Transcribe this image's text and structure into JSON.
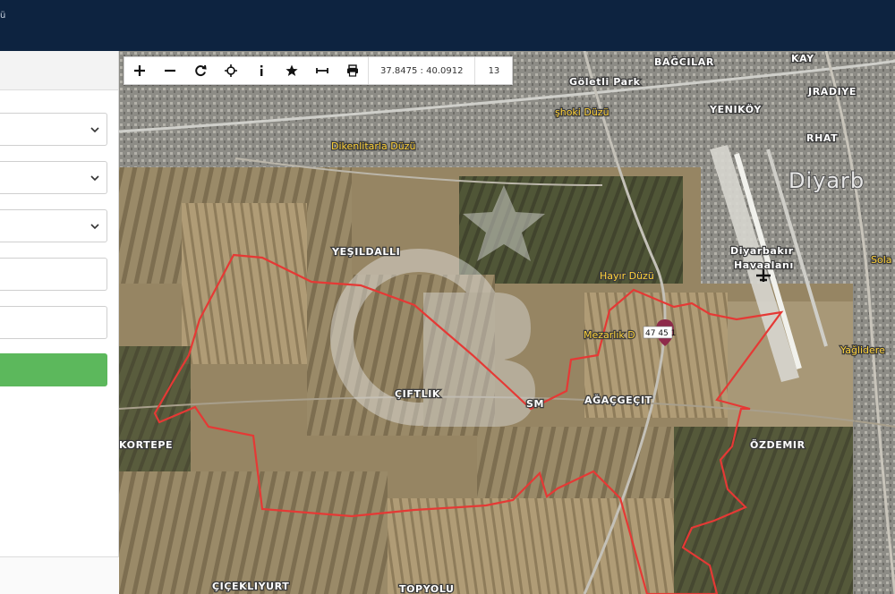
{
  "header": {
    "crumb": "ü"
  },
  "toolbar": {
    "tools": [
      {
        "name": "zoom-in-button",
        "icon": "plus-icon"
      },
      {
        "name": "zoom-out-button",
        "icon": "minus-icon"
      },
      {
        "name": "refresh-button",
        "icon": "refresh-icon"
      },
      {
        "name": "locate-button",
        "icon": "crosshair-icon"
      },
      {
        "name": "info-button",
        "icon": "info-icon"
      },
      {
        "name": "favorite-button",
        "icon": "star-icon"
      },
      {
        "name": "measure-button",
        "icon": "measure-icon"
      },
      {
        "name": "print-button",
        "icon": "print-icon"
      }
    ],
    "coordinates": "37.8475 : 40.0912",
    "zoom_level": "13"
  },
  "map": {
    "labels": {
      "bagcilar": "BAĞCILAR",
      "kay": "KAY",
      "goletli": "Göletli Park",
      "jradiye": "JRADIYE",
      "sohoki": "şhoki Düzü",
      "yenikoy": "YENIKÖY",
      "dikenli": "Dikenlitarla Düzü",
      "rhat": "RHAT",
      "diyarb": "Diyarb",
      "yesildalli": "YEŞILDALLI",
      "airport1": "Diyarbakır",
      "airport2": "Havaalanı",
      "solak": "Sola",
      "hayir": "Hayır Düzü",
      "mezarlik": "Mezarlık D",
      "parcel": "47 45 1",
      "yaglidere": "Yağlidere",
      "ciftlik": "ÇIFTLIK",
      "sm": "SM",
      "agacgecit": "AĞAÇGEÇIT",
      "kortepe": "KORTEPE",
      "ozdemir": "ÖZDEMIR",
      "cicekliyurt": "ÇIÇEKLIYURT",
      "topyolu": "TOPYOLU"
    },
    "colors": {
      "boundary": "#e53935",
      "label_fill": "#ffffff",
      "label_yellow": "#ffd23a",
      "go_button": "#5cb85c",
      "header": "#0d2340"
    }
  }
}
